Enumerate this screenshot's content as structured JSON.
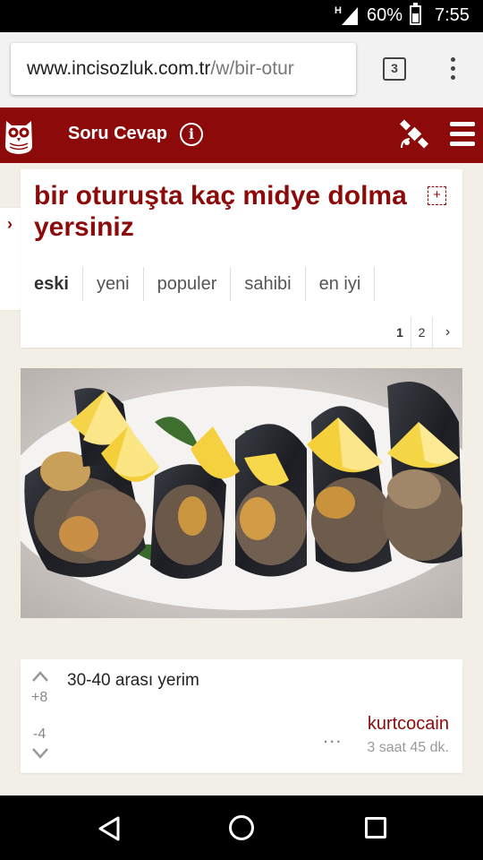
{
  "status_bar": {
    "network": "H",
    "battery": "60%",
    "time": "7:55"
  },
  "browser": {
    "url_domain": "www.incisozluk.com.tr",
    "url_path": "/w/bir-otur",
    "tab_count": "3"
  },
  "header": {
    "title": "Soru Cevap",
    "brand_color": "#8c0a0a"
  },
  "topic": {
    "title": "bir oturuşta kaç midye dolma yersiniz",
    "sort_tabs": [
      "eski",
      "yeni",
      "populer",
      "sahibi",
      "en iyi"
    ],
    "active_tab": "eski",
    "pages": [
      "1",
      "2"
    ],
    "current_page": "1"
  },
  "entry": {
    "text": "30-40 arası yerim",
    "upvotes": "+8",
    "downvotes": "-4",
    "author": "kurtcocain",
    "time": "3 saat 45 dk.",
    "menu": "..."
  }
}
